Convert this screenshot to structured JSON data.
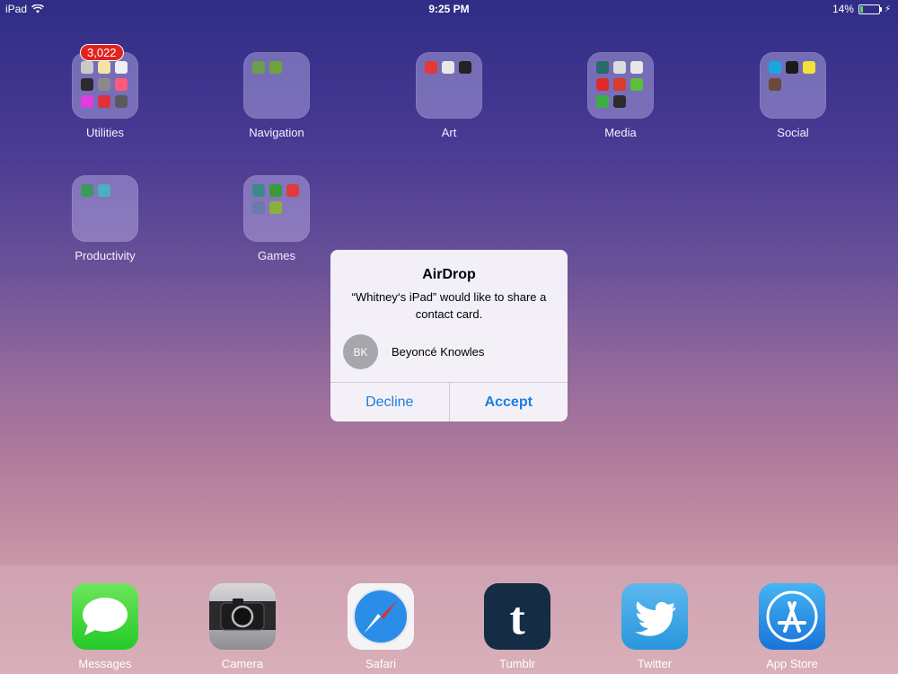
{
  "status_bar": {
    "device": "iPad",
    "time": "9:25 PM",
    "battery": "14%",
    "battery_level": 0.14
  },
  "folders": [
    {
      "label": "Utilities",
      "badge": "3,022",
      "icons": [
        "#c9c9c9",
        "#f2e4a6",
        "#efefef",
        "#2b2b2b",
        "#8a8a8a",
        "#ff5a7c",
        "#e03ce0",
        "#e0303a",
        "#5a5a5a"
      ]
    },
    {
      "label": "Navigation",
      "icons": [
        "#6a9f4a",
        "#6fa23d"
      ]
    },
    {
      "label": "Art",
      "icons": [
        "#e03a3a",
        "#e8e8e8",
        "#222222"
      ]
    },
    {
      "label": "Media",
      "icons": [
        "#2a6a6a",
        "#dcdcdc",
        "#e8e8e8",
        "#e02a2a",
        "#d83c2a",
        "#5cbf3a",
        "#3ab040",
        "#2c2c2c"
      ]
    },
    {
      "label": "Social",
      "icons": [
        "#1aa6e0",
        "#1a1a1a",
        "#f2e23a",
        "#6a4a3a"
      ]
    },
    {
      "label": "Productivity",
      "icons": [
        "#3a9a5a",
        "#4ab0c0"
      ]
    },
    {
      "label": "Games",
      "icons": [
        "#3a8a8a",
        "#3a9a3a",
        "#e03a3a",
        "#6a7aaa",
        "#8ab03a"
      ]
    }
  ],
  "alert": {
    "title": "AirDrop",
    "message": "“Whitney‘s iPad” would like to share a contact card.",
    "contact_initials": "BK",
    "contact_name": "Beyoncé Knowles",
    "decline_label": "Decline",
    "accept_label": "Accept"
  },
  "dock": [
    {
      "name": "Messages",
      "icon": "messages-icon"
    },
    {
      "name": "Camera",
      "icon": "camera-icon"
    },
    {
      "name": "Safari",
      "icon": "safari-icon"
    },
    {
      "name": "Tumblr",
      "icon": "tumblr-icon"
    },
    {
      "name": "Twitter",
      "icon": "twitter-icon"
    },
    {
      "name": "App Store",
      "icon": "app-store-icon"
    }
  ],
  "colors": {
    "alert_button": "#1a7ee0",
    "badge": "#e0231f"
  }
}
